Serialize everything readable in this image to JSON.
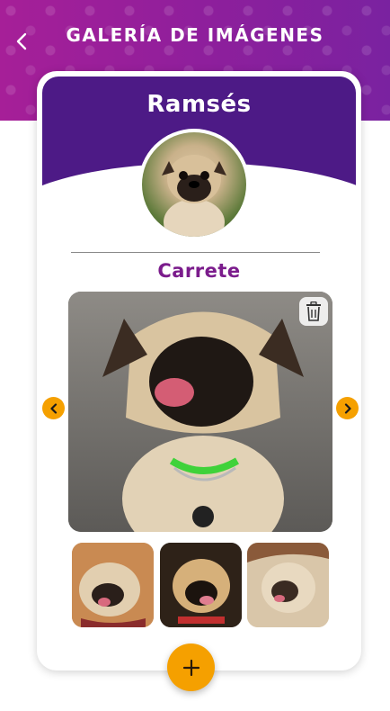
{
  "header": {
    "title": "GALERÍA DE IMÁGENES",
    "back_icon": "chevron-left-icon"
  },
  "profile": {
    "name": "Ramsés",
    "avatar": "pug-avatar-photo"
  },
  "gallery": {
    "section_title": "Carrete",
    "main_photo": "pug-tongue-out-photo",
    "delete_icon": "trash-icon",
    "prev_icon": "chevron-left-icon",
    "next_icon": "chevron-right-icon",
    "thumbnails": [
      "pug-thumbnail-1",
      "pug-thumbnail-2",
      "pug-thumbnail-3"
    ]
  },
  "actions": {
    "add_icon": "plus-icon"
  },
  "colors": {
    "header_purple": "#a0219a",
    "card_top_purple": "#4d1a86",
    "section_title_purple": "#7b1c8c",
    "accent_orange": "#f5a000"
  }
}
